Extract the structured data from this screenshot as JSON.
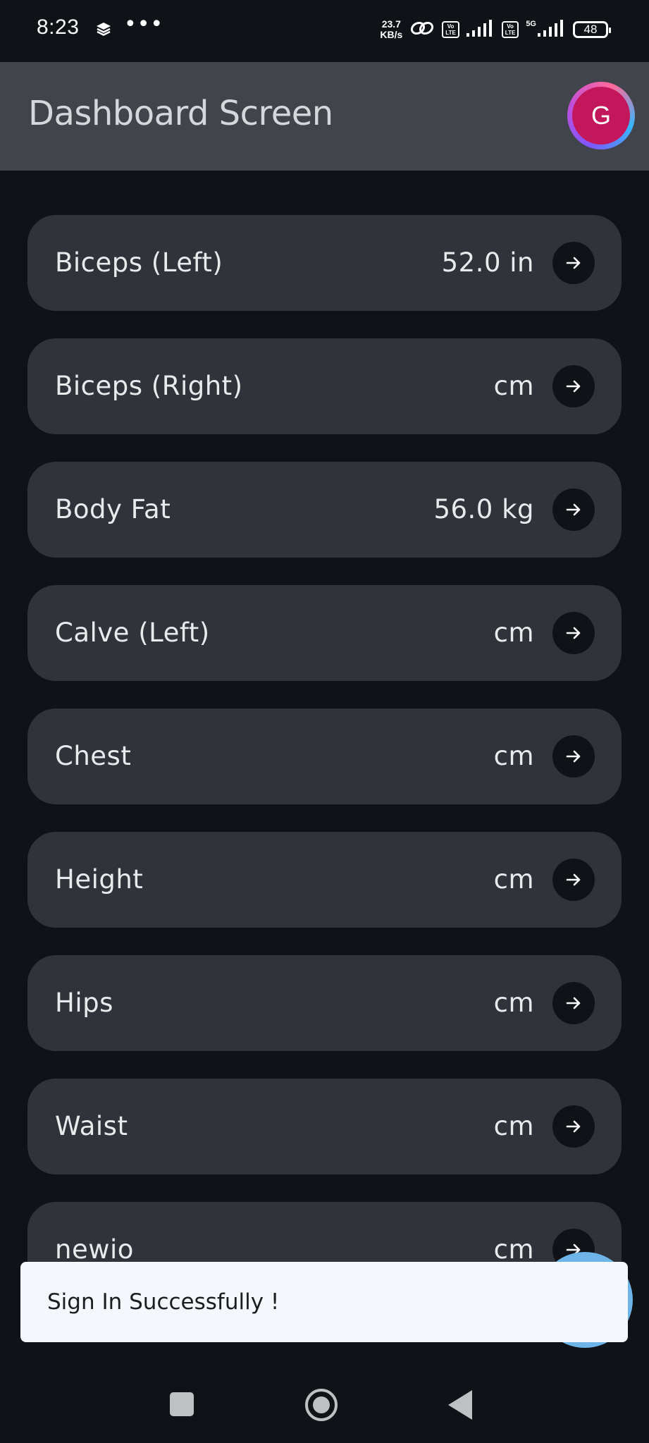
{
  "status_bar": {
    "time": "8:23",
    "dots": "•••",
    "net_speed_value": "23.7",
    "net_speed_unit": "KB/s",
    "volte1_line1": "Vo",
    "volte1_line2": "LTE",
    "volte2_line1": "Vo",
    "volte2_line2": "LTE",
    "network_type": "5G",
    "battery": "48"
  },
  "app_bar": {
    "title": "Dashboard Screen",
    "avatar_initial": "G"
  },
  "measurements": [
    {
      "label": "Biceps (Left)",
      "value": "52.0 in"
    },
    {
      "label": "Biceps (Right)",
      "value": "cm"
    },
    {
      "label": "Body Fat",
      "value": "56.0 kg"
    },
    {
      "label": "Calve (Left)",
      "value": "cm"
    },
    {
      "label": "Chest",
      "value": "cm"
    },
    {
      "label": "Height",
      "value": "cm"
    },
    {
      "label": "Hips",
      "value": "cm"
    },
    {
      "label": "Waist",
      "value": "cm"
    },
    {
      "label": "newio",
      "value": "cm"
    }
  ],
  "snackbar": {
    "message": "Sign In Successfully !"
  },
  "colors": {
    "background": "#0f1216",
    "app_bar": "#41444b",
    "card": "#30333a",
    "avatar": "#c2185b",
    "fab": "#6fb4e8",
    "snackbar": "#f4f7fb"
  },
  "icons": {
    "card_action": "arrow-right-icon",
    "nav_recent": "square-icon",
    "nav_home": "circle-icon",
    "nav_back": "triangle-back-icon"
  }
}
